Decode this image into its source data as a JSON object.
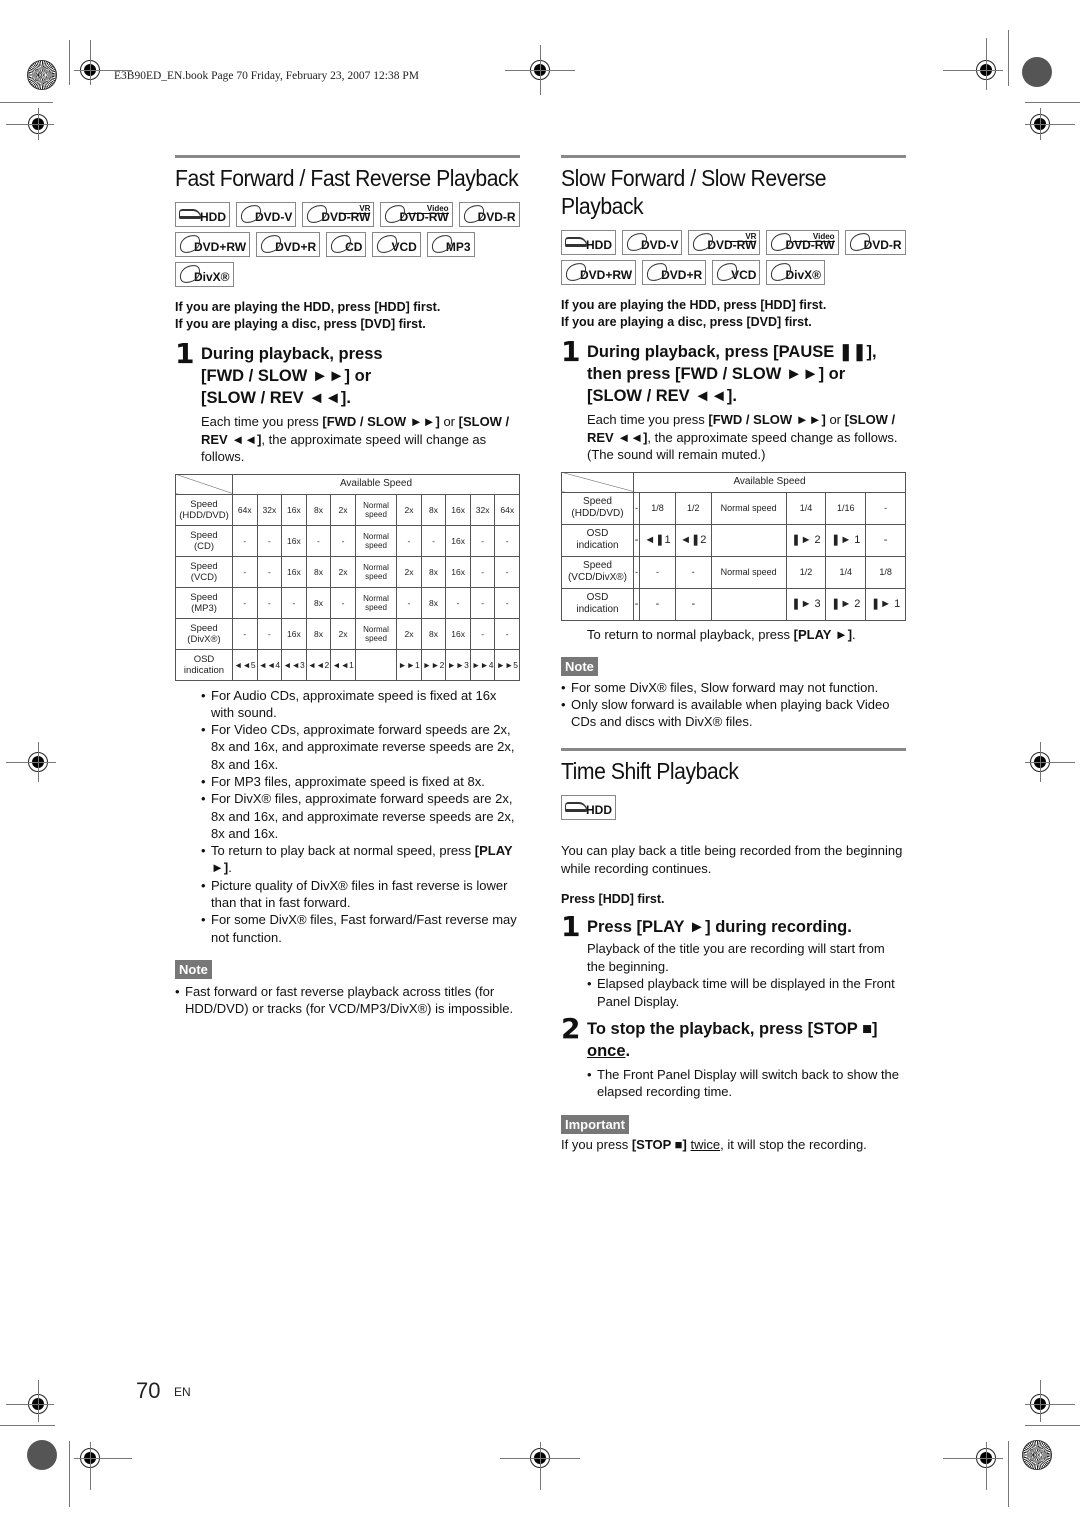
{
  "print_header": "E3B90ED_EN.book  Page 70  Friday, February 23, 2007  12:38 PM",
  "left": {
    "title": "Fast Forward / Fast Reverse Playback",
    "badges": [
      {
        "label": "HDD",
        "kind": "hdd",
        "sup": ""
      },
      {
        "label": "DVD-V",
        "kind": "disc",
        "sup": ""
      },
      {
        "label": "DVD-RW",
        "kind": "disc",
        "sup": "VR"
      },
      {
        "label": "DVD-RW",
        "kind": "disc",
        "sup": "Video"
      },
      {
        "label": "DVD-R",
        "kind": "disc",
        "sup": ""
      },
      {
        "label": "DVD+RW",
        "kind": "disc",
        "sup": ""
      },
      {
        "label": "DVD+R",
        "kind": "disc",
        "sup": ""
      },
      {
        "label": "CD",
        "kind": "disc",
        "sup": ""
      },
      {
        "label": "VCD",
        "kind": "disc",
        "sup": ""
      },
      {
        "label": "MP3",
        "kind": "disc",
        "sup": ""
      },
      {
        "label": "DivX®",
        "kind": "disc",
        "sup": ""
      }
    ],
    "pre_note_1": "If you are playing the HDD, press [HDD] first.",
    "pre_note_2": "If you are playing a disc, press [DVD] first.",
    "step1": {
      "num": "1",
      "title_1": "During playback, press",
      "title_2": "[FWD / SLOW ►►] or",
      "title_3": "[SLOW / REV ◄◄].",
      "body_pre": "Each time you press ",
      "body_b1": "[FWD / SLOW ►►]",
      "body_mid": " or ",
      "body_b2": "[SLOW / REV ◄◄]",
      "body_post": ", the approximate speed will change as follows."
    },
    "table": {
      "header": "Available Speed",
      "rows": [
        {
          "label_1": "Speed",
          "label_2": "(HDD/DVD)",
          "cells": [
            "64x",
            "32x",
            "16x",
            "8x",
            "2x",
            "Normal speed",
            "2x",
            "8x",
            "16x",
            "32x",
            "64x"
          ]
        },
        {
          "label_1": "Speed",
          "label_2": "(CD)",
          "cells": [
            "-",
            "-",
            "16x",
            "-",
            "-",
            "Normal speed",
            "-",
            "-",
            "16x",
            "-",
            "-"
          ]
        },
        {
          "label_1": "Speed",
          "label_2": "(VCD)",
          "cells": [
            "-",
            "-",
            "16x",
            "8x",
            "2x",
            "Normal speed",
            "2x",
            "8x",
            "16x",
            "-",
            "-"
          ]
        },
        {
          "label_1": "Speed",
          "label_2": "(MP3)",
          "cells": [
            "-",
            "-",
            "-",
            "8x",
            "-",
            "Normal speed",
            "-",
            "8x",
            "-",
            "-",
            "-"
          ]
        },
        {
          "label_1": "Speed",
          "label_2": "(DivX®)",
          "cells": [
            "-",
            "-",
            "16x",
            "8x",
            "2x",
            "Normal speed",
            "2x",
            "8x",
            "16x",
            "-",
            "-"
          ]
        },
        {
          "label_1": "OSD",
          "label_2": "indication",
          "cells": [
            "◄◄5",
            "◄◄4",
            "◄◄3",
            "◄◄2",
            "◄◄1",
            "",
            "►►1",
            "►►2",
            "►►3",
            "►►4",
            "►►5"
          ]
        }
      ]
    },
    "bullets": [
      "For Audio CDs, approximate speed is fixed at 16x with sound.",
      "For Video CDs, approximate forward speeds are 2x, 8x and 16x, and approximate reverse speeds are 2x, 8x and 16x.",
      "For MP3 files, approximate speed is fixed at 8x.",
      "For DivX® files, approximate forward speeds are 2x, 8x and 16x, and approximate reverse speeds are 2x, 8x and 16x.",
      "To return to play back at normal speed, press ",
      "Picture quality of DivX® files in fast reverse is lower than that in fast forward.",
      "For some DivX® files, Fast forward/Fast reverse may not function."
    ],
    "play_key": "[PLAY ►]",
    "note_label": "Note",
    "note_bullets": [
      "Fast forward or fast reverse playback across titles (for HDD/DVD) or tracks (for VCD/MP3/DivX®) is impossible."
    ]
  },
  "right": {
    "title_1": "Slow Forward / Slow Reverse",
    "title_2": "Playback",
    "badges": [
      {
        "label": "HDD",
        "kind": "hdd",
        "sup": ""
      },
      {
        "label": "DVD-V",
        "kind": "disc",
        "sup": ""
      },
      {
        "label": "DVD-RW",
        "kind": "disc",
        "sup": "VR"
      },
      {
        "label": "DVD-RW",
        "kind": "disc",
        "sup": "Video"
      },
      {
        "label": "DVD-R",
        "kind": "disc",
        "sup": ""
      },
      {
        "label": "DVD+RW",
        "kind": "disc",
        "sup": ""
      },
      {
        "label": "DVD+R",
        "kind": "disc",
        "sup": ""
      },
      {
        "label": "VCD",
        "kind": "disc",
        "sup": ""
      },
      {
        "label": "DivX®",
        "kind": "disc",
        "sup": ""
      }
    ],
    "pre_note_1": "If you are playing the HDD, press [HDD] first.",
    "pre_note_2": "If you are playing a disc, press [DVD] first.",
    "step1": {
      "num": "1",
      "title_1": "During playback, press [PAUSE ❚❚],",
      "title_2": "then press [FWD / SLOW ►►] or",
      "title_3": "[SLOW / REV ◄◄].",
      "body_pre": "Each time you press ",
      "body_b1": "[FWD / SLOW ►►]",
      "body_mid": " or ",
      "body_b2": "[SLOW / REV ◄◄]",
      "body_post": ", the approximate speed change as follows.",
      "body_extra": "(The sound will remain muted.)"
    },
    "table": {
      "header": "Available Speed",
      "rows": [
        {
          "label_1": "Speed",
          "label_2": "(HDD/DVD)",
          "cells": [
            "-",
            "1/8",
            "1/2",
            "Normal speed",
            "1/4",
            "1/16",
            "-"
          ]
        },
        {
          "label_1": "OSD",
          "label_2": "indication",
          "cells": [
            "-",
            "◄❚1",
            "◄❚2",
            "",
            "❚► 2",
            "❚► 1",
            "-"
          ]
        },
        {
          "label_1": "Speed",
          "label_2": "(VCD/DivX®)",
          "cells": [
            "-",
            "-",
            "-",
            "Normal speed",
            "1/2",
            "1/4",
            "1/8"
          ]
        },
        {
          "label_1": "OSD",
          "label_2": "indication",
          "cells": [
            "-",
            "-",
            "-",
            "",
            "❚► 3",
            "❚► 2",
            "❚► 1"
          ]
        }
      ]
    },
    "return_pre": "To return to normal playback, press ",
    "return_key": "[PLAY ►]",
    "return_post": ".",
    "note_label": "Note",
    "note_bullets": [
      "For some DivX® files, Slow forward may not function.",
      "Only slow forward is available when playing back Video CDs and discs with DivX® files."
    ],
    "ts": {
      "title": "Time Shift Playback",
      "badge": "HDD",
      "intro": "You can play back a title being recorded from the beginning while recording continues.",
      "pre_note": "Press [HDD] first.",
      "step1_num": "1",
      "step1_title": "Press [PLAY ►] during recording.",
      "step1_body": "Playback of the title you are recording will start from the beginning.",
      "step1_bullet": "Elapsed playback time will be displayed in the Front Panel Display.",
      "step2_num": "2",
      "step2_title": "To stop the playback, press [STOP ■]",
      "step2_title_u": "once",
      "step2_title_end": ".",
      "step2_bullet": "The Front Panel Display will switch back to show the elapsed recording time.",
      "important_label": "Important",
      "important_pre": "If you press ",
      "important_key": "[STOP ■]",
      "important_u": "twice",
      "important_post": ", it will stop the recording."
    }
  },
  "footer": {
    "page_number": "70",
    "language": "EN"
  }
}
